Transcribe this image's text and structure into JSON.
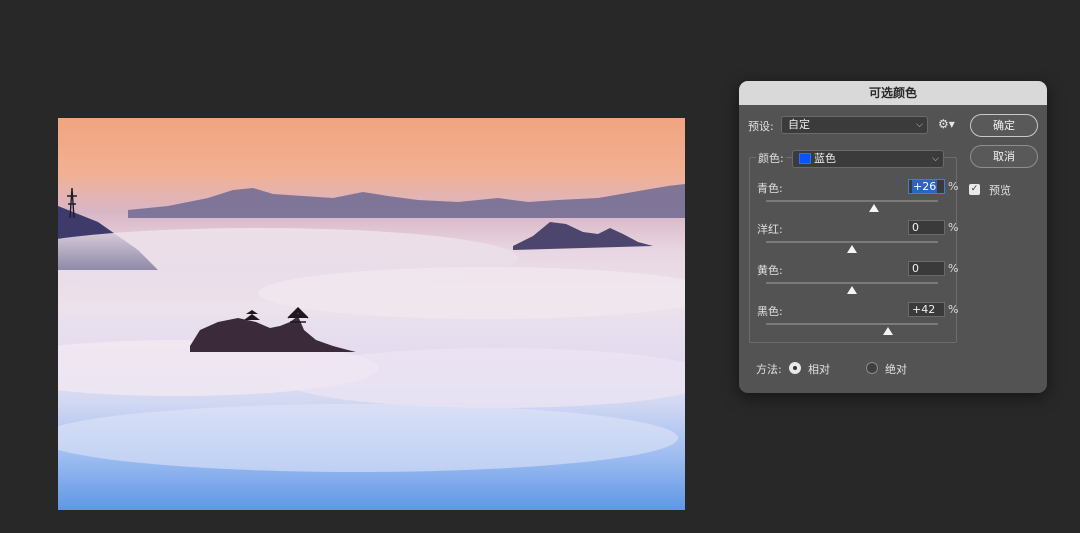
{
  "dialog": {
    "title": "可选颜色",
    "preset_label": "预设:",
    "preset_value": "自定",
    "ok_label": "确定",
    "cancel_label": "取消",
    "preview_label": "预览",
    "preview_checked": true,
    "colors_label": "颜色:",
    "colors_value": "蓝色",
    "colors_swatch": "#0a54f6",
    "sliders": [
      {
        "label": "青色:",
        "value": "+26",
        "percent_sign": "%",
        "level": 0.63
      },
      {
        "label": "洋红:",
        "value": "0",
        "percent_sign": "%",
        "level": 0.5
      },
      {
        "label": "黄色:",
        "value": "0",
        "percent_sign": "%",
        "level": 0.5
      },
      {
        "label": "黑色:",
        "value": "+42",
        "percent_sign": "%",
        "level": 0.71
      }
    ],
    "method_label": "方法:",
    "method_options": [
      {
        "label": "相对",
        "selected": true
      },
      {
        "label": "绝对",
        "selected": false
      }
    ],
    "icons": {
      "gear": "gear-icon",
      "chevron": "chevron-down-icon"
    }
  }
}
